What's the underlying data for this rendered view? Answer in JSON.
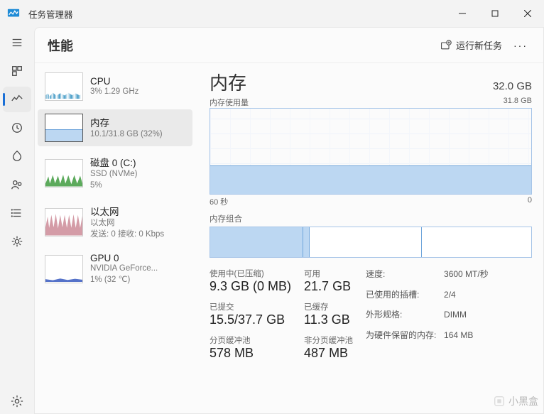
{
  "window": {
    "title": "任务管理器"
  },
  "header": {
    "title": "性能",
    "run_task": "运行新任务"
  },
  "nav": {
    "items": [
      "menu",
      "processes",
      "performance",
      "history",
      "startup",
      "users",
      "details",
      "services"
    ],
    "settings": "settings"
  },
  "list": {
    "cpu": {
      "title": "CPU",
      "sub": "3% 1.29 GHz"
    },
    "mem": {
      "title": "内存",
      "sub": "10.1/31.8 GB (32%)"
    },
    "disk": {
      "title": "磁盘 0 (C:)",
      "sub1": "SSD (NVMe)",
      "sub2": "5%"
    },
    "eth": {
      "title": "以太网",
      "sub1": "以太网",
      "sub2": "发送: 0 接收: 0 Kbps"
    },
    "gpu": {
      "title": "GPU 0",
      "sub1": "NVIDIA GeForce...",
      "sub2": "1% (32 ℃)"
    }
  },
  "main": {
    "title": "内存",
    "capacity": "32.0 GB",
    "usage_label": "内存使用量",
    "usage_right": "31.8 GB",
    "axis_left": "60 秒",
    "axis_right": "0",
    "composition_label": "内存组合",
    "stats": {
      "in_use_lbl": "使用中(已压缩)",
      "in_use_val": "9.3 GB (0 MB)",
      "available_lbl": "可用",
      "available_val": "21.7 GB",
      "committed_lbl": "已提交",
      "committed_val": "15.5/37.7 GB",
      "cached_lbl": "已缓存",
      "cached_val": "11.3 GB",
      "paged_lbl": "分页缓冲池",
      "paged_val": "578 MB",
      "nonpaged_lbl": "非分页缓冲池",
      "nonpaged_val": "487 MB"
    },
    "kv": {
      "speed_k": "速度:",
      "speed_v": "3600 MT/秒",
      "slots_k": "已使用的插槽:",
      "slots_v": "2/4",
      "form_k": "外形规格:",
      "form_v": "DIMM",
      "hw_k": "为硬件保留的内存:",
      "hw_v": "164 MB"
    }
  },
  "watermark": "小黑盒",
  "chart_data": {
    "type": "area",
    "title": "内存使用量",
    "x": "60 秒 → 0",
    "ylim": [
      0,
      31.8
    ],
    "unit": "GB",
    "series": [
      {
        "name": "内存使用量",
        "values": [
          10.1,
          10.1,
          10.1,
          10.1,
          10.1,
          10.1,
          10.1,
          10.1,
          10.1,
          10.1,
          10.1,
          10.1,
          10.1,
          10.1,
          10.1,
          10.1,
          10.1,
          10.1,
          10.1,
          10.1
        ]
      }
    ],
    "composition": {
      "in_use_gb": 9.3,
      "modified_gb": 0.7,
      "standby_gb": 11.3,
      "free_gb": 10.5,
      "total_gb": 31.8
    }
  }
}
